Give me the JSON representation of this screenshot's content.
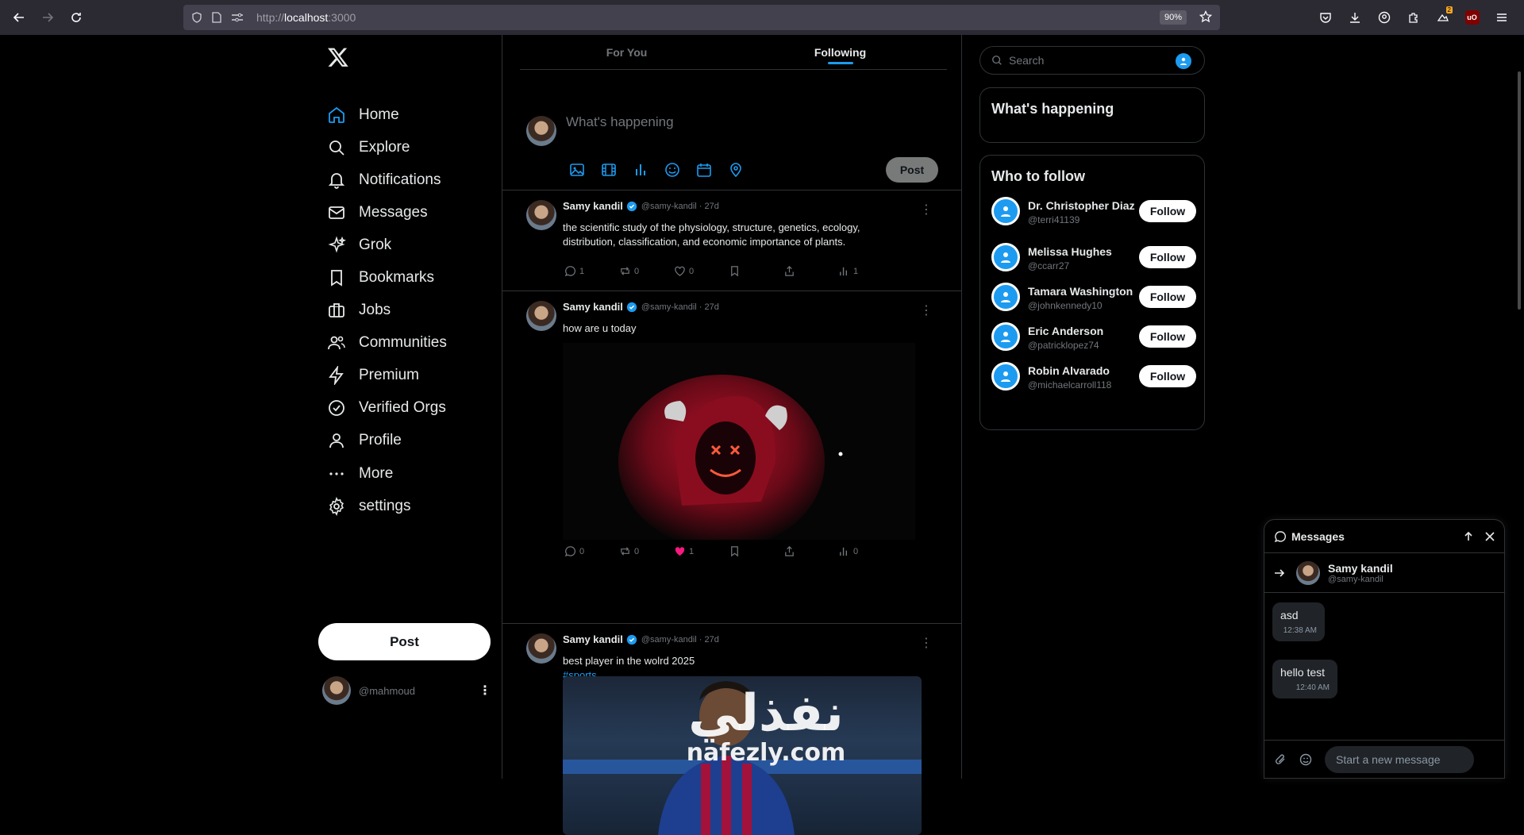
{
  "browser": {
    "url_prefix": "http://",
    "url_host": "localhost",
    "url_port": ":3000",
    "zoom": "90%",
    "ext_badge": "2",
    "ublock_label": "uO"
  },
  "nav": {
    "items": [
      {
        "label": "Home",
        "icon": "home-icon"
      },
      {
        "label": "Explore",
        "icon": "search-icon"
      },
      {
        "label": "Notifications",
        "icon": "bell-icon"
      },
      {
        "label": "Messages",
        "icon": "mail-icon"
      },
      {
        "label": "Grok",
        "icon": "grok-icon"
      },
      {
        "label": "Bookmarks",
        "icon": "bookmark-icon"
      },
      {
        "label": "Jobs",
        "icon": "briefcase-icon"
      },
      {
        "label": "Communities",
        "icon": "people-icon"
      },
      {
        "label": "Premium",
        "icon": "lightning-icon"
      },
      {
        "label": "Verified Orgs",
        "icon": "check-circle-icon"
      },
      {
        "label": "Profile",
        "icon": "person-icon"
      },
      {
        "label": "More",
        "icon": "more-icon"
      },
      {
        "label": "settings",
        "icon": "gear-icon"
      }
    ],
    "post_label": "Post",
    "me_handle": "@mahmoud"
  },
  "tabs": {
    "for_you": "For You",
    "following": "Following"
  },
  "compose": {
    "placeholder": "What's happening",
    "post_label": "Post"
  },
  "tweets": [
    {
      "name": "Samy kandil",
      "meta": "@samy-kandil · 27d",
      "text": "the scientific study of the physiology, structure, genetics, ecology, distribution, classification, and economic importance of plants.",
      "replies": "1",
      "reposts": "0",
      "likes": "0",
      "views": "1"
    },
    {
      "name": "Samy kandil",
      "meta": "@samy-kandil · 27d",
      "text": "how are u today",
      "replies": "0",
      "reposts": "0",
      "likes": "1",
      "views": "0"
    },
    {
      "name": "Samy kandil",
      "meta": "@samy-kandil · 27d",
      "text": "best player in the wolrd 2025",
      "hashtag": "#sports"
    }
  ],
  "right": {
    "search_placeholder": "Search",
    "whats_happening": "What's happening",
    "who_to_follow": "Who to follow",
    "follow_label": "Follow",
    "suggestions": [
      {
        "name": "Dr. Christopher Diaz",
        "handle": "@terri41139"
      },
      {
        "name": "Melissa Hughes",
        "handle": "@ccarr27"
      },
      {
        "name": "Tamara Washington",
        "handle": "@johnkennedy10"
      },
      {
        "name": "Eric Anderson",
        "handle": "@patricklopez74"
      },
      {
        "name": "Robin Alvarado",
        "handle": "@michaelcarroll118"
      }
    ]
  },
  "messages": {
    "title": "Messages",
    "user_name": "Samy kandil",
    "user_handle": "@samy-kandil",
    "items": [
      {
        "text": "asd",
        "time": "12:38 AM"
      },
      {
        "text": "hello test",
        "time": "12:40 AM"
      }
    ],
    "input_placeholder": "Start a new message"
  },
  "watermark": {
    "arabic": "نفذلي",
    "latin": "nafezly.com"
  },
  "colors": {
    "accent": "#1d9bf0",
    "like": "#f91880",
    "border": "#2f3336"
  }
}
